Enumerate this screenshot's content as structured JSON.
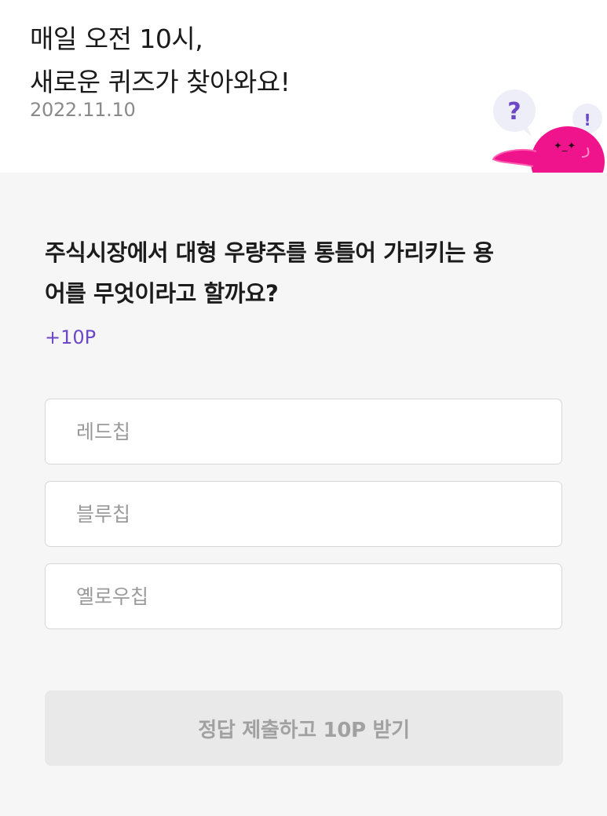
{
  "header": {
    "title_line1": "매일 오전 10시,",
    "title_line2": "새로운 퀴즈가 찾아와요!",
    "date": "2022.11.10"
  },
  "mascot": {
    "question_mark": "?",
    "exclamation_mark": "!",
    "body_color": "#f0148c",
    "bubble_color": "#eeeef8",
    "symbol_color": "#6c47c6"
  },
  "quiz": {
    "question_line1": "주식시장에서 대형 우량주를 통틀어 가리키는 용",
    "question_line2": "어를 무엇이라고 할까요?",
    "points": "+10P",
    "options": [
      {
        "label": "레드칩"
      },
      {
        "label": "블루칩"
      },
      {
        "label": "옐로우칩"
      }
    ],
    "submit_label": "정답 제출하고 10P 받기"
  },
  "colors": {
    "accent_purple": "#6c47c6",
    "submit_disabled_bg": "#e9e9e9",
    "submit_disabled_text": "#a1a1a1"
  }
}
